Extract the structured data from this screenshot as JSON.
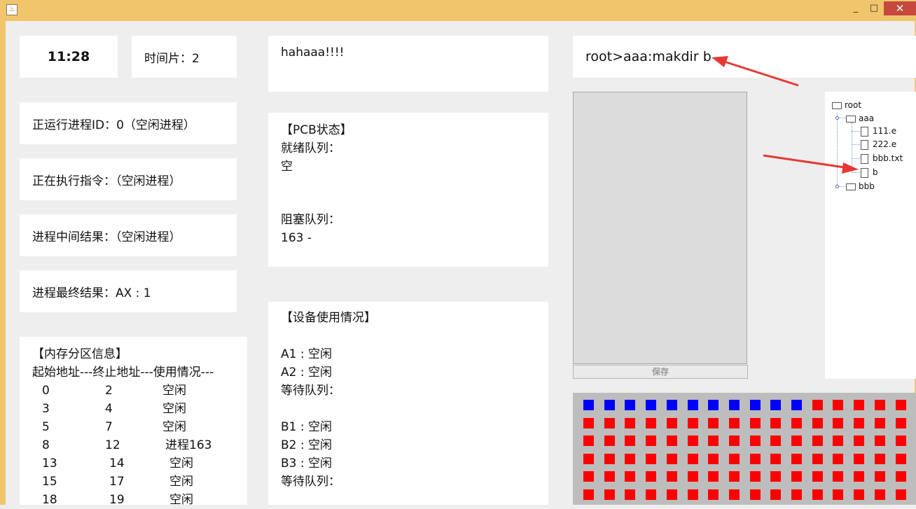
{
  "window": {
    "minimize": "_",
    "maximize": "□",
    "close": "✕"
  },
  "clock": "11:28",
  "time_slice": "时间片：2",
  "status": {
    "running_process": "正运行进程ID：0（空闲进程）",
    "executing_instruction": "正在执行指令：（空闲进程）",
    "intermediate_result": "进程中间结果：（空闲进程）",
    "final_result": "进程最终结果：AX : 1"
  },
  "memory": {
    "title": "【内存分区信息】",
    "header": "起始地址---终止地址---使用情况---",
    "rows": [
      {
        "start": "0",
        "end": "2",
        "state": "空闲"
      },
      {
        "start": "3",
        "end": "4",
        "state": "空闲"
      },
      {
        "start": "5",
        "end": "7",
        "state": "空闲"
      },
      {
        "start": "8",
        "end": "12",
        "state": "进程163"
      },
      {
        "start": "13",
        "end": "14",
        "state": "空闲"
      },
      {
        "start": "15",
        "end": "17",
        "state": "空闲"
      },
      {
        "start": "18",
        "end": "19",
        "state": "空闲"
      }
    ]
  },
  "message": "hahaaa!!!!",
  "pcb": {
    "title": "【PCB状态】",
    "ready_label": "就绪队列：",
    "ready_value": "空",
    "blocked_label": "阻塞队列：",
    "blocked_value": "163  -"
  },
  "devices": {
    "title": "【设备使用情况】",
    "a1": "A1 : 空闲",
    "a2": "A2 : 空闲",
    "a_wait": "等待队列：",
    "b1": "B1 : 空闲",
    "b2": "B2 : 空闲",
    "b3": "B3 : 空闲",
    "b_wait": "等待队列："
  },
  "command": "root>aaa:makdir b",
  "editor": {
    "save_label": "保存"
  },
  "tree": {
    "root": "root",
    "aaa": "aaa",
    "files": [
      "111.e",
      "222.e",
      "bbb.txt",
      "b"
    ],
    "bbb": "bbb"
  },
  "disk_grid": {
    "columns": 16,
    "rows": 6,
    "used_blocks_in_first_row": 11,
    "colors": {
      "free_or_used_blue": "#0000ff",
      "red": "#ff0000",
      "background": "#bdbdbd"
    }
  },
  "colors": {
    "titlebar": "#f0c56b",
    "arrow": "#e53935"
  }
}
